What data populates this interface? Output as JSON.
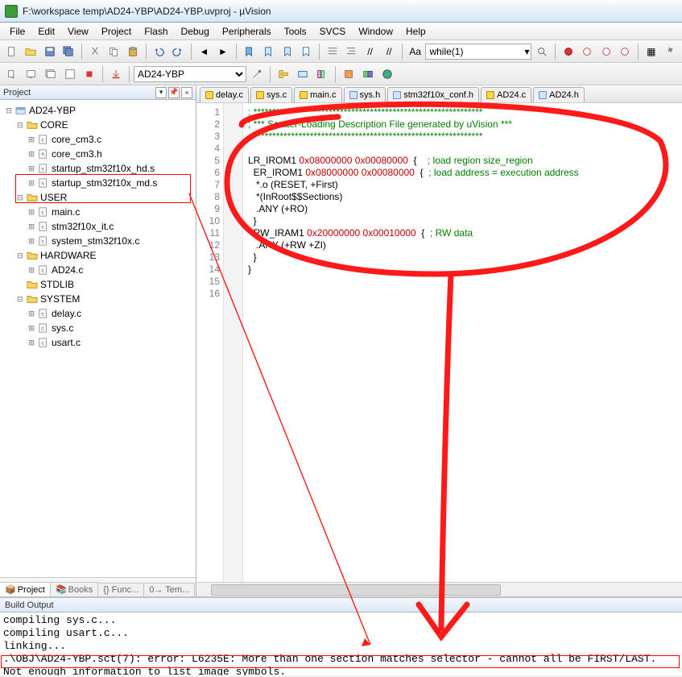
{
  "window": {
    "title": "F:\\workspace temp\\AD24-YBP\\AD24-YBP.uvproj - µVision"
  },
  "menu": [
    "File",
    "Edit",
    "View",
    "Project",
    "Flash",
    "Debug",
    "Peripherals",
    "Tools",
    "SVCS",
    "Window",
    "Help"
  ],
  "toolbar": {
    "search_value": "while(1)"
  },
  "toolbar2": {
    "target": "AD24-YBP"
  },
  "project_panel": {
    "title": "Project",
    "tabs": [
      "Project",
      "Books",
      "{} Func...",
      "0→ Tem..."
    ],
    "root": "AD24-YBP",
    "groups": [
      {
        "name": "CORE",
        "files": [
          "core_cm3.c",
          "core_cm3.h",
          "startup_stm32f10x_hd.s",
          "startup_stm32f10x_md.s"
        ]
      },
      {
        "name": "USER",
        "files": [
          "main.c",
          "stm32f10x_it.c",
          "system_stm32f10x.c"
        ]
      },
      {
        "name": "HARDWARE",
        "files": [
          "AD24.c"
        ]
      },
      {
        "name": "STDLIB",
        "files": []
      },
      {
        "name": "SYSTEM",
        "files": [
          "delay.c",
          "sys.c",
          "usart.c"
        ]
      }
    ]
  },
  "editor_tabs": [
    {
      "label": "delay.c",
      "kind": "c"
    },
    {
      "label": "sys.c",
      "kind": "c"
    },
    {
      "label": "main.c",
      "kind": "c"
    },
    {
      "label": "sys.h",
      "kind": "h"
    },
    {
      "label": "stm32f10x_conf.h",
      "kind": "h"
    },
    {
      "label": "AD24.c",
      "kind": "c"
    },
    {
      "label": "AD24.h",
      "kind": "h"
    }
  ],
  "code": {
    "lines": [
      "; *************************************************************",
      "; *** Scatter-Loading Description File generated by uVision ***",
      "; *************************************************************",
      "",
      "LR_IROM1 0x08000000 0x00080000  {    ; load region size_region",
      "  ER_IROM1 0x08000000 0x00080000  {  ; load address = execution address",
      "   *.o (RESET, +First)",
      "   *(InRoot$$Sections)",
      "   .ANY (+RO)",
      "  }",
      "  RW_IRAM1 0x20000000 0x00010000  {  ; RW data",
      "   .ANY (+RW +ZI)",
      "  }",
      "}",
      "",
      ""
    ]
  },
  "build_output": {
    "title": "Build Output",
    "lines": [
      "compiling sys.c...",
      "compiling usart.c...",
      "linking...",
      ".\\OBJ\\AD24-YBP.sct(7): error: L6235E: More than one section matches selector - cannot all be FIRST/LAST.",
      "Not enough information to list image symbols."
    ]
  }
}
